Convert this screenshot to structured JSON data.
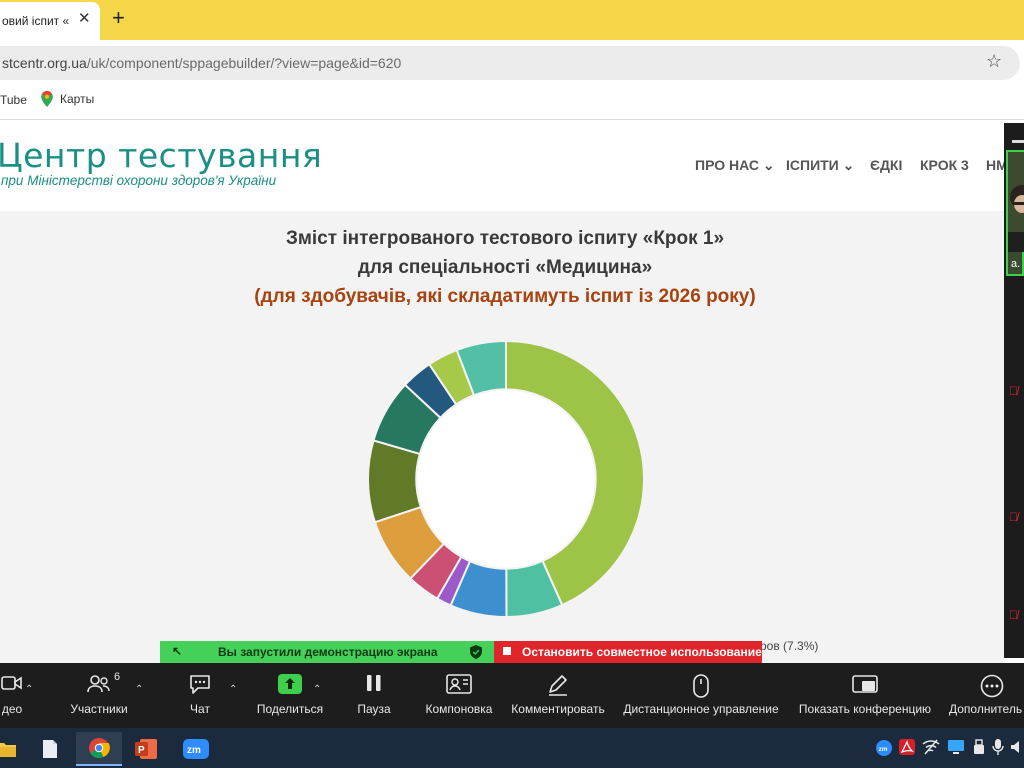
{
  "browser": {
    "tab_title": "овий іспит «",
    "new_tab_symbol": "+",
    "url_host": "stcentr.org.ua",
    "url_path": "/uk/component/sppagebuilder/?view=page&id=620",
    "bookmarks": [
      {
        "label": "Tube",
        "icon": "youtube-icon"
      },
      {
        "label": "Карты",
        "icon": "google-maps-icon"
      }
    ]
  },
  "site": {
    "logo_title": "Центр тестування",
    "logo_subtitle": "при Міністерстві охорони здоров'я України",
    "nav": [
      {
        "label": "ПРО НАС",
        "dropdown": true
      },
      {
        "label": "ІСПИТИ",
        "dropdown": true
      },
      {
        "label": "ЄДКІ",
        "dropdown": false
      },
      {
        "label": "КРОК 3",
        "dropdown": false
      },
      {
        "label": "НМ",
        "dropdown": false
      }
    ]
  },
  "page": {
    "title_line1": "Зміст інтегрованого тестового іспиту «Крок 1»",
    "title_line2": "для спеціальності «Медицина»",
    "title_line3": "(для здобувачів, які складатимуть іспит із 2026 року)",
    "legend_tail": "ров (7.3%)"
  },
  "chart_data": {
    "type": "pie",
    "values": [
      42.5,
      6.5,
      6.5,
      1.7,
      3.8,
      7.6,
      9.4,
      7.3,
      3.6,
      3.5,
      5.7
    ],
    "colors": [
      "#9dc347",
      "#4fc1a2",
      "#3d8fd0",
      "#9b59c9",
      "#cc4f74",
      "#dd9d3c",
      "#617a28",
      "#277860",
      "#23587f",
      "#a7c94a",
      "#53bfa4"
    ],
    "legend_visible_fragment": "ров (7.3%)",
    "hole_ratio": 0.65
  },
  "share": {
    "green_text": "Вы запустили демонстрацию экрана",
    "red_text": "Остановить совместное использование"
  },
  "zoom": {
    "participants_count": "6",
    "buttons": [
      {
        "label": "део",
        "icon": "video-camera-icon"
      },
      {
        "label": "Участники",
        "icon": "participants-icon"
      },
      {
        "label": "Чат",
        "icon": "chat-icon"
      },
      {
        "label": "Поделиться",
        "icon": "share-screen-icon"
      },
      {
        "label": "Пауза",
        "icon": "pause-icon"
      },
      {
        "label": "Компоновка",
        "icon": "layout-icon"
      },
      {
        "label": "Комментировать",
        "icon": "annotate-pen-icon"
      },
      {
        "label": "Дистанционное управление",
        "icon": "mouse-icon"
      },
      {
        "label": "Показать конференцию",
        "icon": "show-meeting-icon"
      },
      {
        "label": "Дополнитель",
        "icon": "more-icon"
      }
    ],
    "side_name": "a."
  },
  "taskbar": {
    "apps": [
      "file-explorer-icon",
      "notepad-icon",
      "chrome-icon",
      "powerpoint-icon",
      "zoom-icon"
    ],
    "tray": [
      "zoom-tray-icon",
      "acrobat-tray-icon",
      "wifi-off-tray-icon",
      "display-tray-icon",
      "usb-tray-icon",
      "mic-tray-icon",
      "volume-tray-icon"
    ]
  }
}
